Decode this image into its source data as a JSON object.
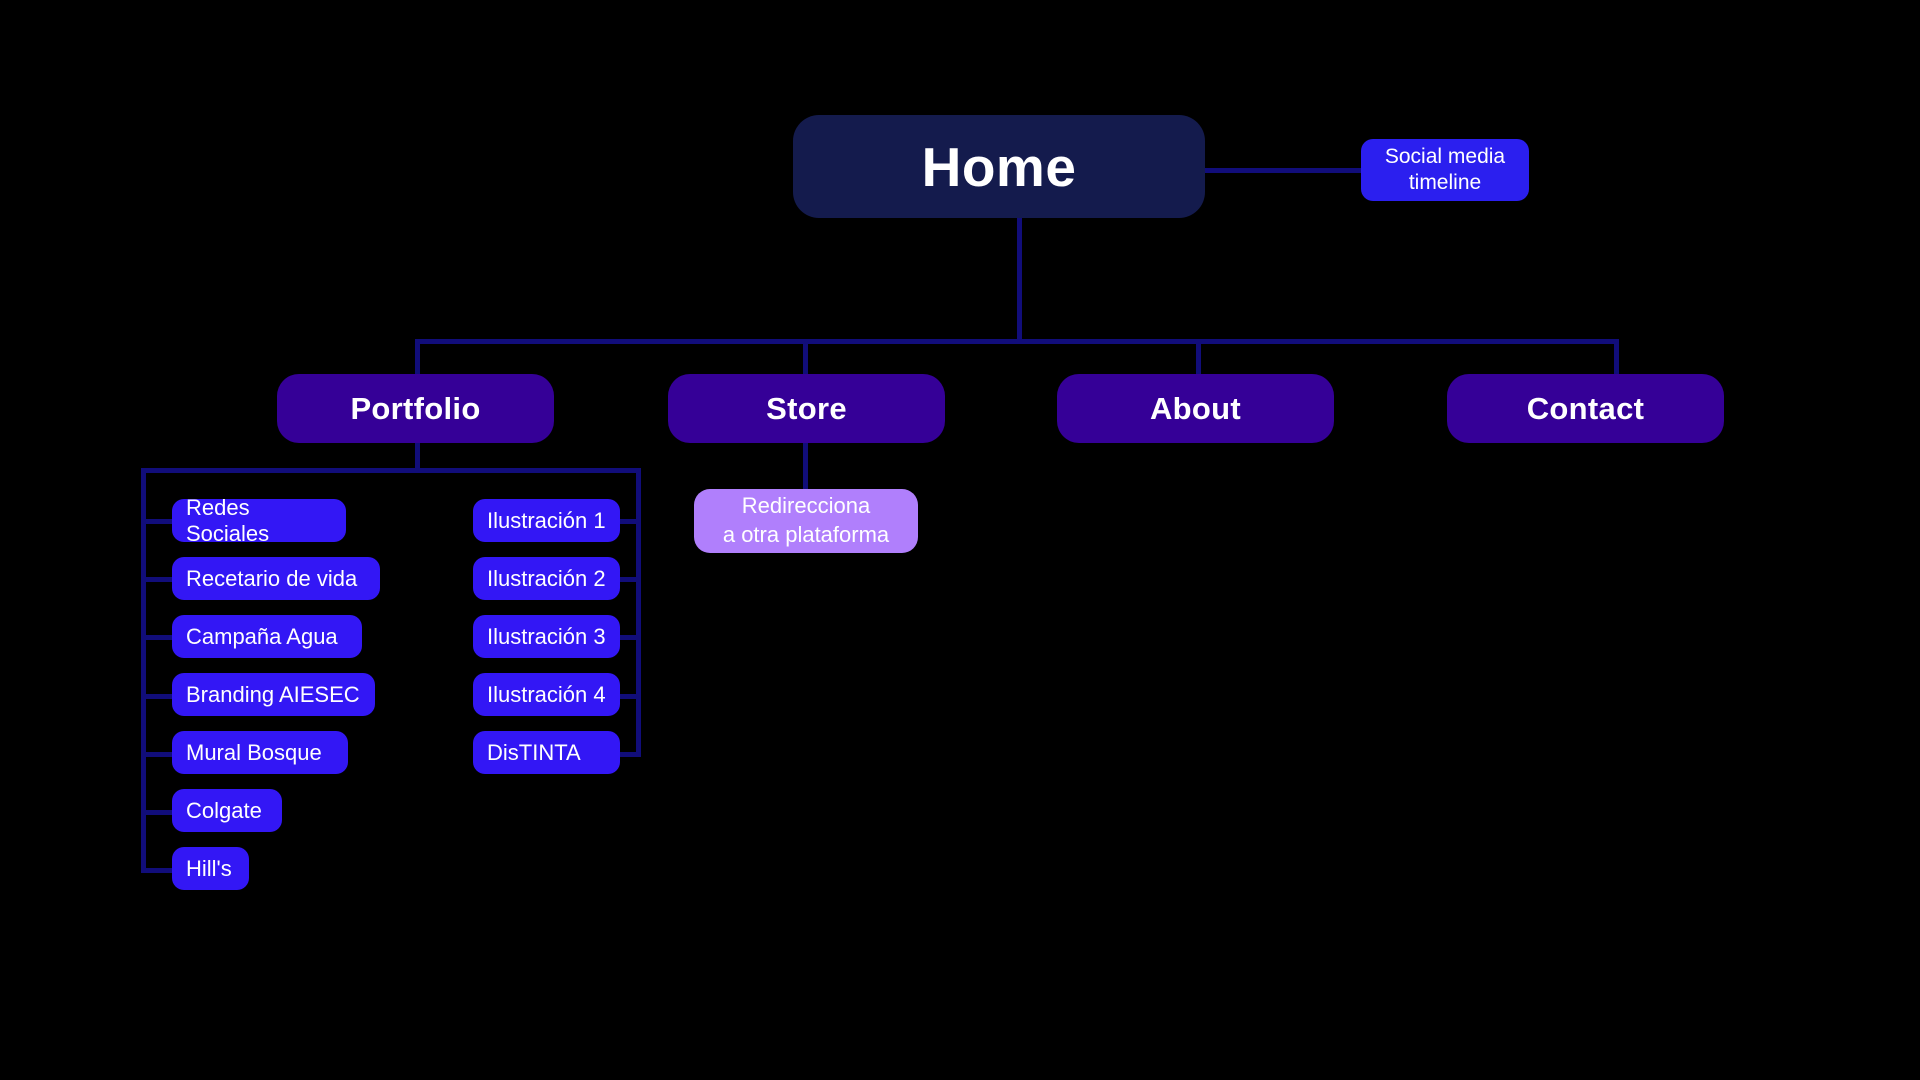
{
  "diagram": {
    "title_node": {
      "label": "Home"
    },
    "side_note": {
      "line1": "Social media",
      "line2": "timeline"
    },
    "sections": [
      {
        "label": "Portfolio"
      },
      {
        "label": "Store"
      },
      {
        "label": "About"
      },
      {
        "label": "Contact"
      }
    ],
    "store_note": {
      "line1": "Redirecciona",
      "line2": "a otra plataforma"
    },
    "portfolio_left": [
      {
        "label": "Redes Sociales"
      },
      {
        "label": "Recetario de vida"
      },
      {
        "label": "Campaña Agua"
      },
      {
        "label": "Branding AIESEC"
      },
      {
        "label": "Mural Bosque"
      },
      {
        "label": "Colgate"
      },
      {
        "label": "Hill's"
      }
    ],
    "portfolio_right": [
      {
        "label": "Ilustración 1"
      },
      {
        "label": "Ilustración 2"
      },
      {
        "label": "Ilustración 3"
      },
      {
        "label": "Ilustración 4"
      },
      {
        "label": "DisTINTA"
      }
    ],
    "colors": {
      "background": "#000000",
      "root_node": "#141b4d",
      "section_node": "#350097",
      "leaf_node": "#3317f5",
      "note_node": "#2b1fef",
      "redirect_node": "#b07ffc",
      "connector": "#110d7a",
      "text": "#ffffff"
    }
  }
}
